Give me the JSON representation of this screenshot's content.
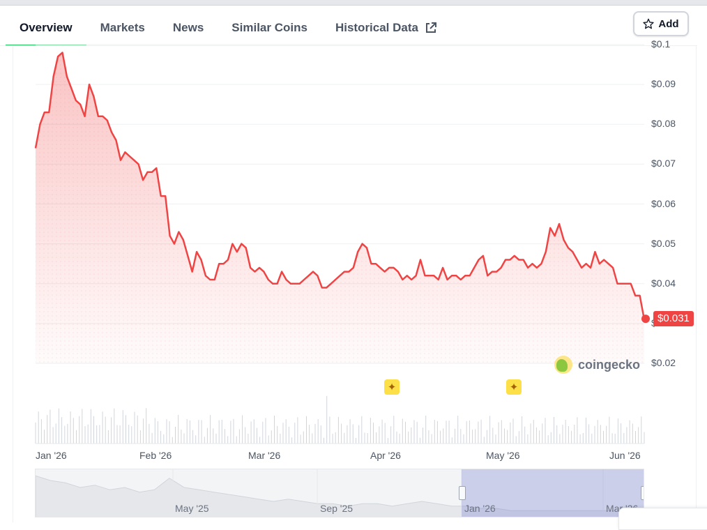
{
  "tabs": [
    {
      "label": "Overview",
      "active": true
    },
    {
      "label": "Markets"
    },
    {
      "label": "News"
    },
    {
      "label": "Similar Coins"
    },
    {
      "label": "Historical Data",
      "icon": "external-link-icon"
    }
  ],
  "add_button": {
    "label": "Add",
    "icon": "star-outline-icon"
  },
  "price_badge": "$0.031",
  "watermark": "coingecko",
  "chart_data": {
    "type": "area",
    "series": [
      {
        "values": [
          0.074,
          0.08,
          0.083,
          0.083,
          0.092,
          0.097,
          0.098,
          0.092,
          0.089,
          0.086,
          0.085,
          0.082,
          0.09,
          0.087,
          0.082,
          0.082,
          0.081,
          0.078,
          0.076,
          0.071,
          0.073,
          0.072,
          0.071,
          0.07,
          0.066,
          0.068,
          0.068,
          0.069,
          0.062,
          0.062,
          0.052,
          0.05,
          0.053,
          0.051,
          0.047,
          0.043,
          0.048,
          0.046,
          0.042,
          0.041,
          0.041,
          0.045,
          0.045,
          0.046,
          0.05,
          0.048,
          0.05,
          0.049,
          0.044,
          0.043,
          0.044,
          0.043,
          0.041,
          0.04,
          0.04,
          0.043,
          0.041,
          0.04,
          0.04,
          0.04,
          0.041,
          0.042,
          0.043,
          0.042,
          0.039,
          0.039,
          0.04,
          0.041,
          0.042,
          0.043,
          0.043,
          0.044,
          0.048,
          0.05,
          0.049,
          0.045,
          0.045,
          0.044,
          0.043,
          0.044,
          0.044,
          0.043,
          0.041,
          0.042,
          0.041,
          0.042,
          0.046,
          0.042,
          0.042,
          0.042,
          0.041,
          0.044,
          0.041,
          0.042,
          0.042,
          0.041,
          0.042,
          0.042,
          0.044,
          0.046,
          0.047,
          0.042,
          0.043,
          0.043,
          0.044,
          0.046,
          0.046,
          0.047,
          0.046,
          0.046,
          0.044,
          0.045,
          0.044,
          0.045,
          0.048,
          0.054,
          0.052,
          0.055,
          0.051,
          0.049,
          0.048,
          0.046,
          0.044,
          0.045,
          0.044,
          0.048,
          0.045,
          0.046,
          0.045,
          0.044,
          0.04,
          0.04,
          0.04,
          0.04,
          0.037,
          0.037,
          0.031
        ]
      }
    ],
    "yticks": [
      "$0.1",
      "$0.09",
      "$0.08",
      "$0.07",
      "$0.06",
      "$0.05",
      "$0.04",
      "$0.03",
      "$0.02"
    ],
    "ylim": [
      0.02,
      0.1
    ],
    "xticks": [
      "Jan '26",
      "Feb '26",
      "Mar '26",
      "Apr '26",
      "May '26",
      "Jun '26"
    ],
    "grid": true,
    "line_color": "#ef4444",
    "event_markers": 2,
    "navigator_labels": [
      "May '25",
      "Sep '25",
      "Jan '26",
      "Mar '26"
    ],
    "navigator_values": [
      0.17,
      0.15,
      0.14,
      0.12,
      0.13,
      0.11,
      0.12,
      0.1,
      0.11,
      0.16,
      0.12,
      0.11,
      0.1,
      0.09,
      0.08,
      0.07,
      0.06,
      0.07,
      0.06,
      0.05,
      0.05,
      0.04,
      0.05,
      0.05,
      0.04,
      0.05,
      0.06,
      0.05,
      0.04,
      0.04,
      0.03,
      0.03,
      0.02,
      0.02,
      0.02,
      0.02,
      0.02,
      0.02,
      0.02,
      0.02,
      0.02,
      0.02
    ]
  },
  "colors": {
    "accent_green": "#22c55e",
    "line_red": "#ef4444",
    "selection": "#c7cbeb"
  }
}
